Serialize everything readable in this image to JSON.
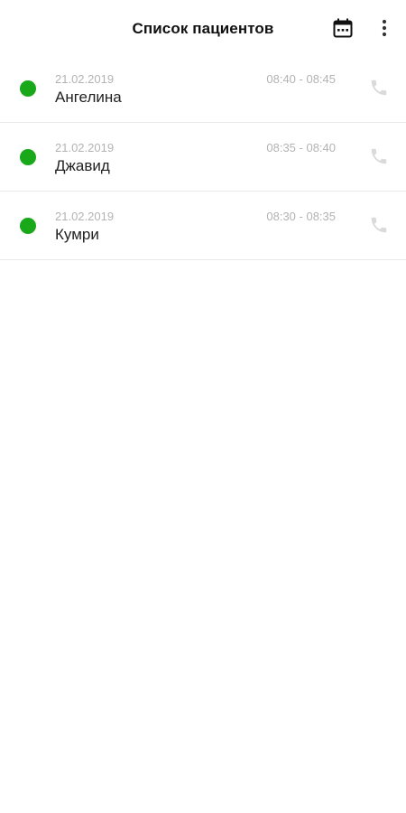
{
  "header": {
    "title": "Список пациентов",
    "calendar_icon": "calendar-icon",
    "more_icon": "more-vert-icon"
  },
  "colors": {
    "status_active": "#18a81a",
    "secondary_text": "#b3b3b3",
    "call_icon": "#dadada"
  },
  "patients": [
    {
      "date": "21.02.2019",
      "time": "08:40 - 08:45",
      "name": "Ангелина",
      "status": "active",
      "icon": "phone-icon"
    },
    {
      "date": "21.02.2019",
      "time": "08:35 - 08:40",
      "name": "Джавид",
      "status": "active",
      "icon": "phone-icon"
    },
    {
      "date": "21.02.2019",
      "time": "08:30 - 08:35",
      "name": "Кумри",
      "status": "active",
      "icon": "phone-icon"
    }
  ]
}
